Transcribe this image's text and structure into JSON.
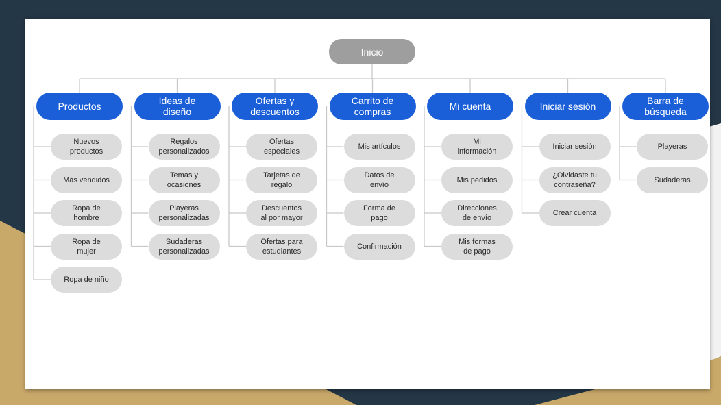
{
  "colors": {
    "dark_background": "#243746",
    "gold_background": "#c9a96a",
    "root_fill": "#9e9e9e",
    "category_fill": "#1a5fd8",
    "leaf_fill": "#dcdcdc",
    "connector": "#c8c8c8"
  },
  "sitemap": {
    "root": "Inicio",
    "categories": [
      {
        "label": "Productos",
        "items": [
          "Nuevos\nproductos",
          "Más vendidos",
          "Ropa de\nhombre",
          "Ropa de\nmujer",
          "Ropa de niño"
        ]
      },
      {
        "label": "Ideas de\ndiseño",
        "items": [
          "Regalos\npersonalizados",
          "Temas y\nocasiones",
          "Playeras\npersonalizadas",
          "Sudaderas\npersonalizadas"
        ]
      },
      {
        "label": "Ofertas y\ndescuentos",
        "items": [
          "Ofertas\nespeciales",
          "Tarjetas de\nregalo",
          "Descuentos\nal por mayor",
          "Ofertas para\nestudiantes"
        ]
      },
      {
        "label": "Carrito de\ncompras",
        "items": [
          "Mis artículos",
          "Datos de\nenvío",
          "Forma de\npago",
          "Confirmación"
        ]
      },
      {
        "label": "Mi cuenta",
        "items": [
          "Mi\ninformación",
          "Mis pedidos",
          "Direcciones\nde envío",
          "Mis formas\nde pago"
        ]
      },
      {
        "label": "Iniciar sesión",
        "items": [
          "Iniciar sesión",
          "¿Olvidaste tu\ncontraseña?",
          "Crear cuenta"
        ]
      },
      {
        "label": "Barra de\nbúsqueda",
        "items": [
          "Playeras",
          "Sudaderas"
        ]
      }
    ]
  }
}
